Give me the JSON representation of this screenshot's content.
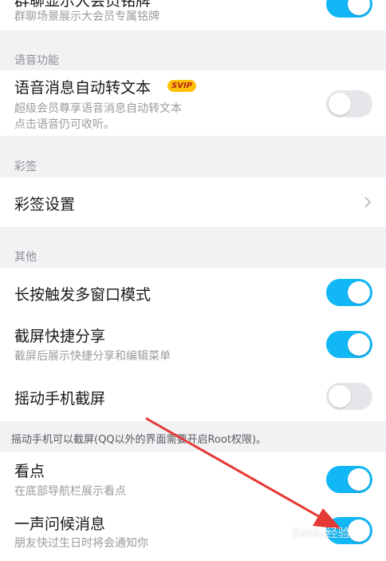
{
  "group_badge": {
    "title": "群聊显示大会员铭牌",
    "subtitle": "群聊场景展示大会员专属铭牌",
    "on": true
  },
  "voice": {
    "section": "语音功能",
    "title": "语音消息自动转文本",
    "badge": "SVIP",
    "subtitle_line1": "超级会员尊享语音消息自动转文本",
    "subtitle_line2": "点击语音仍可收听。",
    "on": false
  },
  "signature": {
    "section": "彩签",
    "title": "彩签设置"
  },
  "other": {
    "section": "其他",
    "items": [
      {
        "title": "长按触发多窗口模式",
        "subtitle": "",
        "on": true
      },
      {
        "title": "截屏快捷分享",
        "subtitle": "截屏后展示快捷分享和编辑菜单",
        "on": true
      },
      {
        "title": "摇动手机截屏",
        "subtitle": "",
        "on": false
      }
    ],
    "note": "摇动手机可以截屏(QQ以外的界面需要开启Root权限)。"
  },
  "bottom": {
    "items": [
      {
        "title": "看点",
        "subtitle": "在底部导航栏展示看点",
        "on": true
      },
      {
        "title": "一声问候消息",
        "subtitle": "朋友快过生日时将会通知你",
        "on": true
      }
    ]
  },
  "watermark": "Baidu经验",
  "colors": {
    "toggle_on": "#12b7f5",
    "toggle_off": "#e6e6ea",
    "arrow": "#e53935",
    "svip_bg": "#ffc107"
  }
}
